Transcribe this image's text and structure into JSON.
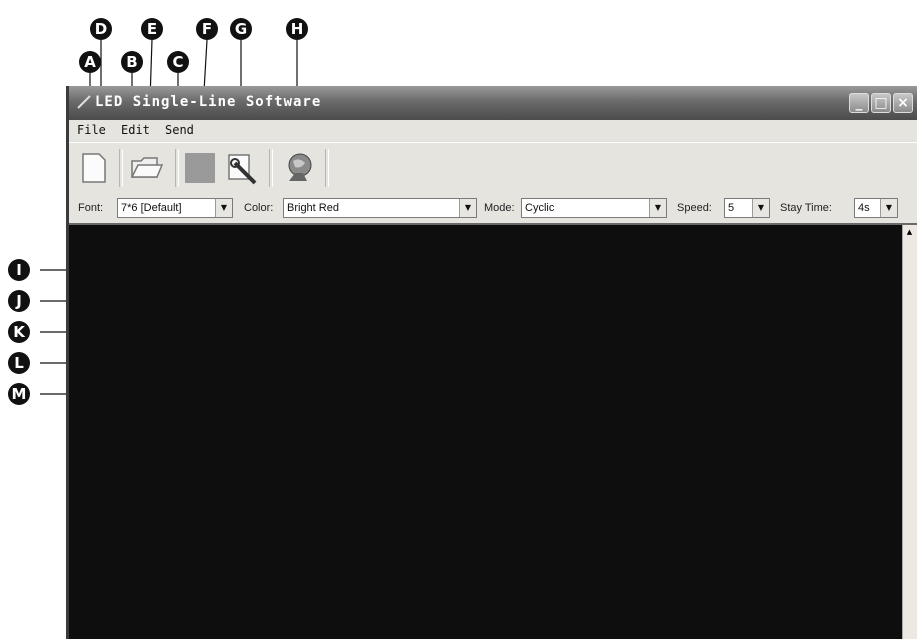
{
  "window": {
    "title": "LED Single-Line Software"
  },
  "menu": {
    "file": "File",
    "edit": "Edit",
    "send": "Send"
  },
  "toolbar": {
    "buttons": [
      "new-file-icon",
      "open-folder-icon",
      "color-square-icon",
      "tools-icon",
      "globe-icon"
    ]
  },
  "options": {
    "font_label": "Font:",
    "font_value": "7*6 [Default]",
    "color_label": "Color:",
    "color_value": "Bright Red",
    "mode_label": "Mode:",
    "mode_value": "Cyclic",
    "speed_label": "Speed:",
    "speed_value": "5",
    "stay_label": "Stay Time:",
    "stay_value": "4s"
  },
  "callouts": {
    "a": "A",
    "b": "B",
    "c": "C",
    "d": "D",
    "e": "E",
    "f": "F",
    "g": "G",
    "h": "H",
    "i": "I",
    "j": "J",
    "k": "K",
    "l": "L",
    "m": "M"
  },
  "colors": {
    "canvas": "#0e0e0e",
    "titlebar": "#6a6a6a",
    "callout": "#111111",
    "color_swatch": "#9a9a9a"
  }
}
